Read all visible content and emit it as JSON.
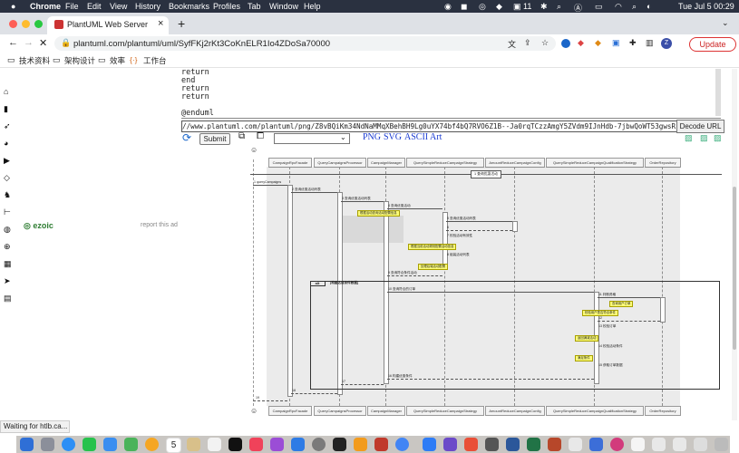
{
  "menubar": {
    "items": [
      "Chrome",
      "File",
      "Edit",
      "View",
      "History",
      "Bookmarks",
      "Profiles",
      "Tab",
      "Window",
      "Help"
    ],
    "clock": "Tue Jul 5  00:29",
    "badge": "11"
  },
  "tab": {
    "title": "PlantUML Web Server",
    "close": "×",
    "new": "+"
  },
  "address": {
    "url": "plantuml.com/plantuml/uml/SyfFKj2rKt3CoKnELR1Io4ZDoSa70000",
    "update_label": "Update",
    "profile_initial": "Z"
  },
  "bookmarks": [
    "技术资料",
    "架构设计",
    "效率",
    "工作台"
  ],
  "code_lines": [
    "return",
    "end",
    "return",
    "return",
    "",
    "@enduml"
  ],
  "url_box": "//www.plantuml.com/plantuml/png/Z8vBQiKm34NdNaMMqXBehBH9Lg0uYX74bf4bQ7RVO6Z1B--Ja0rqTCzzAmgY5ZVdm9IJnHdb-7jbwQoWT53gwsR",
  "buttons": {
    "decode": "Decode URL",
    "submit": "Submit"
  },
  "formats": [
    "PNG",
    "SVG",
    "ASCII Art"
  ],
  "ad": {
    "brand": "ezoic",
    "report": "report this ad"
  },
  "diagram": {
    "participants": [
      "CampaignRpcFacade",
      "QueryCampaignsProcessor",
      "CampaignManager",
      "QuerySimpleReduceCampaignStrategy",
      "AmountReduceCampaignConfig",
      "QuerySimpleReduceCampaignQualificationStrategy",
      "OrderRepository"
    ],
    "divider": "1 查询优惠活动",
    "first_call": "queryCampaigns",
    "alt_label": "alt",
    "alt_cond": "[构建达成条件数据]",
    "numbers": [
      "1",
      "2",
      "3",
      "4",
      "5",
      "6",
      "7",
      "8",
      "9",
      "10",
      "11",
      "12",
      "13",
      "14",
      "15",
      "16",
      "17",
      "18",
      "19"
    ],
    "messages": [
      "查询优惠活动列表",
      "查询优惠活动列表",
      "查询优惠活动",
      "查询优惠活动列表",
      "校验活动有效性",
      "组装活动列表",
      "查询符合条件活动",
      "查询符合的订单",
      "判断资格",
      "校验订单",
      "校验活动条件",
      "获取订单数据",
      "构建优惠条件",
      "返回满减活动",
      "过滤活动列表",
      "返回结果",
      "返回活动列表"
    ],
    "notes": [
      "根据活动查询活动配置信息",
      "根据当前活动规则配置活动信息",
      "处理后端活动配置",
      "查询用户订单",
      "校验用户是否符合条件",
      "返回满减活动",
      "满足条件",
      "构建优惠活动"
    ]
  },
  "status_text": "Waiting for htlb.ca...",
  "dock_badge": "5"
}
